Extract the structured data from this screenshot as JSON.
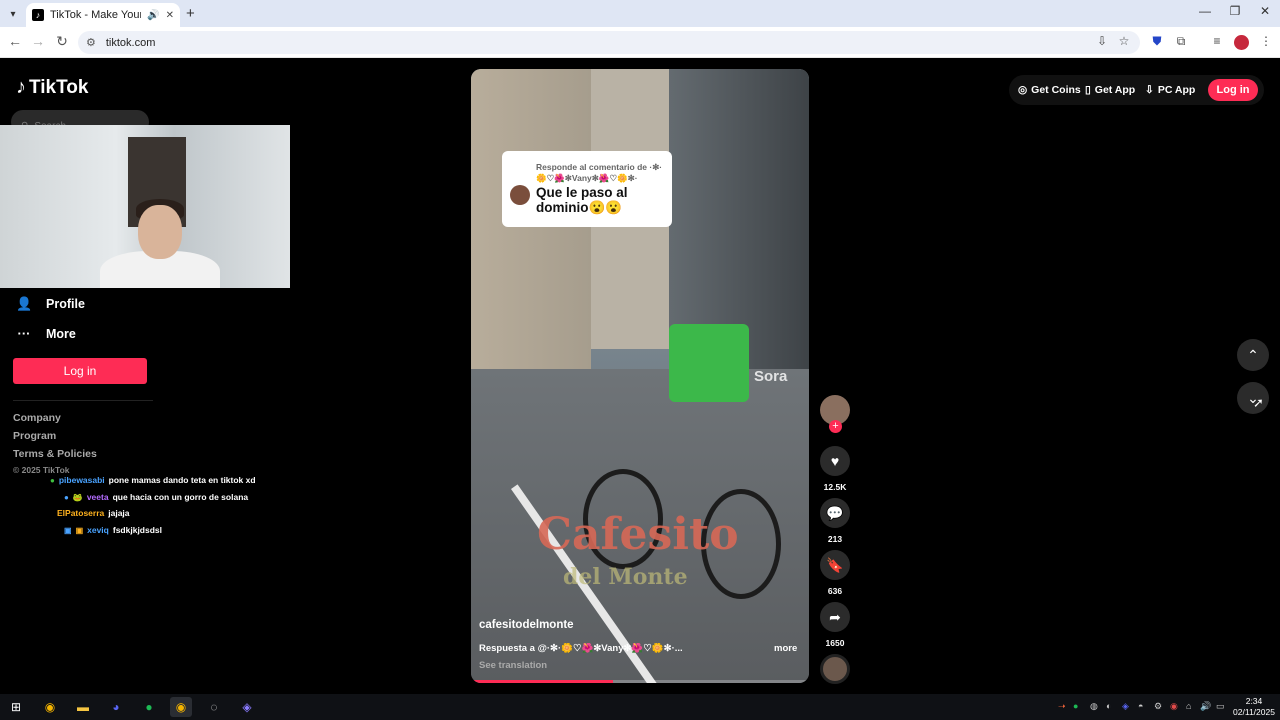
{
  "browser": {
    "tab_title": "TikTok - Make Your Day",
    "url": "tiktok.com",
    "tab_audio_icon": "speaker-icon",
    "tab_close_icon": "close-icon",
    "new_tab_icon": "plus-icon"
  },
  "tiktok": {
    "logo_text": "TikTok",
    "search_placeholder": "Search",
    "nav": {
      "profile": "Profile",
      "more": "More"
    },
    "sidebar_login": "Log in",
    "footer": {
      "company": "Company",
      "program": "Program",
      "terms": "Terms & Policies",
      "copyright": "© 2025 TikTok"
    },
    "header": {
      "get_coins": "Get Coins",
      "get_app": "Get App",
      "pc_app": "PC App",
      "login": "Log in"
    },
    "video": {
      "reply_to": "Responde al comentario de ·✻·🌼♡🌺✻Vany✻🌺♡🌼✻·",
      "comment": "Que le paso al dominio😮😮",
      "watermark": "Sora",
      "brand_line1": "Cafesito",
      "brand_line2": "del Monte",
      "author": "cafesitodelmonte",
      "description": "Respuesta a @·✻·🌼♡🌺✻Vany✻🌺♡🌼✻·...",
      "more": "more",
      "see_translation": "See translation",
      "progress": 0.42
    },
    "actions": {
      "likes": "12.5K",
      "comments": "213",
      "saves": "636",
      "shares": "1650"
    }
  },
  "chat": [
    {
      "user": "pibewasabi",
      "user_color": "#4aa3ff",
      "message": "pone mamas dando teta en tiktok xd"
    },
    {
      "user": "veeta",
      "user_color": "#b46cff",
      "message": "que hacia con un gorro de solana"
    },
    {
      "user": "ElPatoserra",
      "user_color": "#ffb21e",
      "message": "jajaja"
    },
    {
      "user": "xeviq",
      "user_color": "#4aa3ff",
      "message": "fsdkjkjdsdsl"
    }
  ],
  "taskbar": {
    "time": "2:34",
    "date": "02/11/2025"
  },
  "colors": {
    "accent": "#fe2c55"
  }
}
